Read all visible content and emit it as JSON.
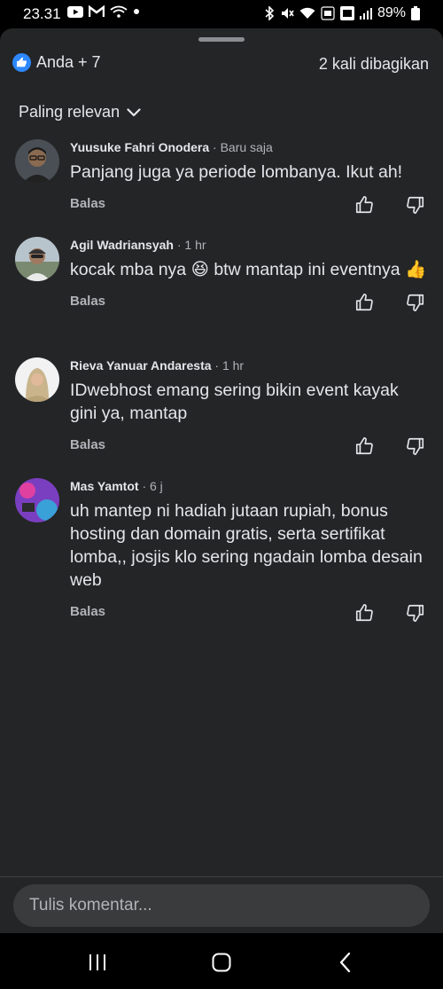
{
  "status_bar": {
    "time": "23.31",
    "battery": "89%"
  },
  "reactions": {
    "label": "Anda + 7",
    "shares": "2 kali dibagikan"
  },
  "sort": {
    "label": "Paling relevan"
  },
  "comments": [
    {
      "name": "Yuusuke Fahri Onodera",
      "time": "· Baru saja",
      "text": "Panjang juga ya periode lombanya. Ikut ah!",
      "reply": "Balas"
    },
    {
      "name": "Agil Wadriansyah",
      "time": "· 1 hr",
      "text": "kocak mba nya 😆 btw mantap ini eventnya 👍",
      "reply": "Balas"
    },
    {
      "name": "Rieva Yanuar Andaresta",
      "time": "· 1 hr",
      "text": "IDwebhost emang sering bikin event kayak gini ya, mantap",
      "reply": "Balas"
    },
    {
      "name": "Mas Yamtot",
      "time": "· 6 j",
      "text": "uh mantep ni hadiah jutaan rupiah, bonus hosting dan domain gratis, serta sertifikat lomba,, josjis klo sering ngadain lomba desain web",
      "reply": "Balas"
    }
  ],
  "composer": {
    "placeholder": "Tulis komentar..."
  },
  "colors": {
    "sheet_bg": "#242526",
    "like_blue": "#2d88ff",
    "muted_text": "#b0b3b8"
  }
}
